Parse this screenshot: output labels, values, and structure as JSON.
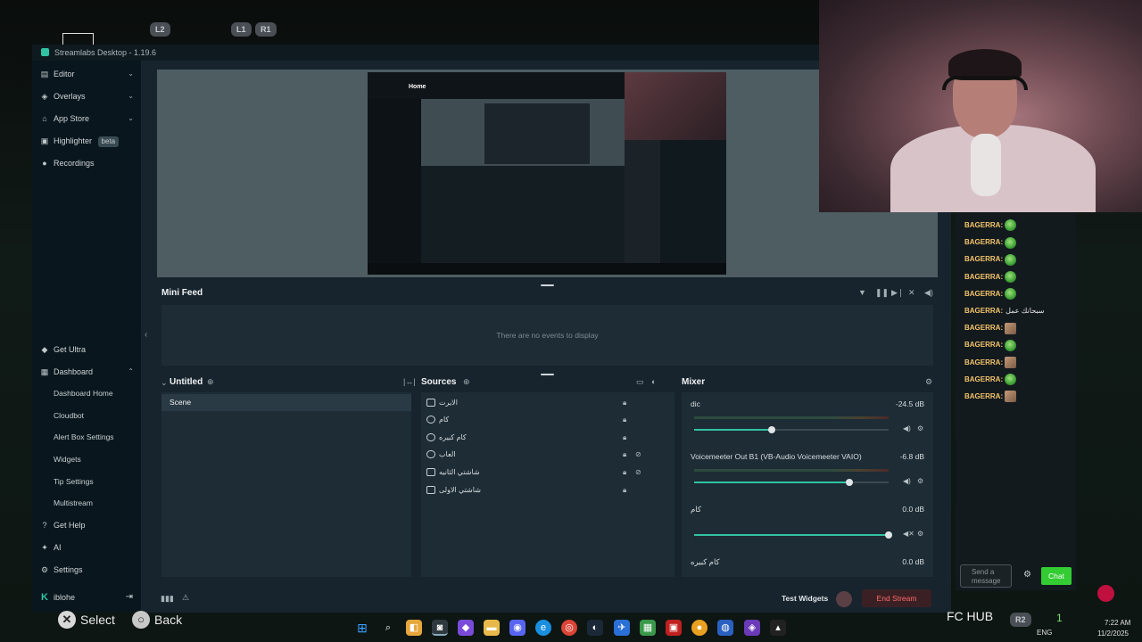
{
  "overlay": {
    "badges": [
      "L2",
      "L1",
      "R1"
    ],
    "pad_hints": {
      "select": "Select",
      "back": "Back"
    },
    "fc_hub": "FC HUB",
    "r2_badge": "R2",
    "r2_count": "1"
  },
  "app": {
    "title": "Streamlabs Desktop - 1.19.6",
    "nav": {
      "editor": "Editor",
      "overlays": "Overlays",
      "app_store": "App Store",
      "highlighter": "Highlighter",
      "highlighter_badge": "beta",
      "recordings": "Recordings",
      "get_ultra": "Get Ultra",
      "dashboard": "Dashboard",
      "dashboard_home": "Dashboard Home",
      "cloudbot": "Cloudbot",
      "alert_box": "Alert Box Settings",
      "widgets": "Widgets",
      "tip_settings": "Tip Settings",
      "multistream": "Multistream",
      "get_help": "Get Help",
      "ai": "AI",
      "settings": "Settings",
      "user": "iblohe"
    },
    "preview_text": {
      "home": "Home"
    },
    "mini_feed": {
      "title": "Mini Feed",
      "empty": "There are no events to display"
    },
    "scenes": {
      "title": "Untitled",
      "items": [
        "Scene"
      ]
    },
    "sources": {
      "title": "Sources",
      "items": [
        {
          "label": "الايرت",
          "icon": "browser-source-icon"
        },
        {
          "label": "كام",
          "icon": "webcam-icon"
        },
        {
          "label": "كام كبيره",
          "icon": "gamepad-icon"
        },
        {
          "label": "العاب",
          "icon": "gamepad-icon"
        },
        {
          "label": "شاشتي الثانيه",
          "icon": "monitor-icon"
        },
        {
          "label": "شاشتي الاولى",
          "icon": "monitor-icon"
        }
      ]
    },
    "mixer": {
      "title": "Mixer",
      "channels": [
        {
          "name": "dic",
          "db": "-24.5 dB",
          "level": 0.4
        },
        {
          "name": "Voicemeeter Out B1 (VB-Audio Voicemeeter VAIO)",
          "db": "-6.8 dB",
          "level": 0.8
        },
        {
          "name": "كام",
          "db": "0.0 dB",
          "level": 1.0
        },
        {
          "name": "كام كبيره",
          "db": "0.0 dB",
          "level": 1.0
        }
      ]
    },
    "footer": {
      "test_widgets": "Test Widgets",
      "end_stream": "End Stream"
    }
  },
  "chat": {
    "messages": [
      {
        "user": "BAGERRA:",
        "text": "",
        "emote": "green"
      },
      {
        "user": "BAGERRA:",
        "text": "",
        "emote": "green"
      },
      {
        "user": "BAGERRA:",
        "text": "",
        "emote": "green"
      },
      {
        "user": "BAGERRA:",
        "text": "",
        "emote": "green"
      },
      {
        "user": "BAGERRA:",
        "text": "",
        "emote": "green"
      },
      {
        "user": "BAGERRA:",
        "text": "سبحانك عمل",
        "emote": ""
      },
      {
        "user": "BAGERRA:",
        "text": "",
        "emote": "tan"
      },
      {
        "user": "BAGERRA:",
        "text": "",
        "emote": "green"
      },
      {
        "user": "BAGERRA:",
        "text": "",
        "emote": "tan"
      },
      {
        "user": "BAGERRA:",
        "text": "",
        "emote": "green"
      },
      {
        "user": "BAGERRA:",
        "text": "",
        "emote": "tan"
      }
    ],
    "input_placeholder": "Send a message",
    "send_label": "Chat"
  },
  "tray": {
    "lang": "ENG",
    "time": "7:22 AM",
    "date": "11/2/2025"
  }
}
